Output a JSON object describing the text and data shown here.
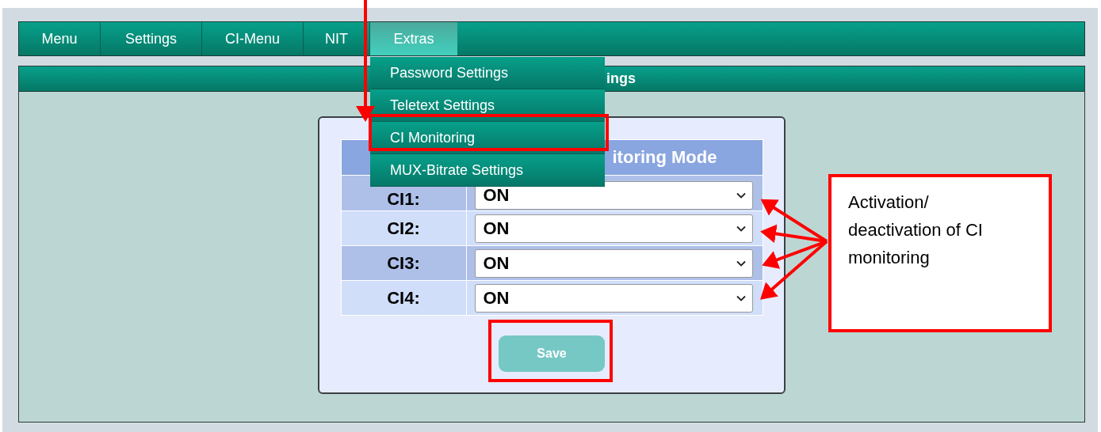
{
  "nav": {
    "tabs": [
      {
        "label": "Menu",
        "selected": false
      },
      {
        "label": "Settings",
        "selected": false
      },
      {
        "label": "CI-Menu",
        "selected": false
      },
      {
        "label": "NIT",
        "selected": false
      },
      {
        "label": "Extras",
        "selected": true
      }
    ]
  },
  "dropdown": {
    "items": [
      "Password Settings",
      "Teletext Settings",
      "CI Monitoring",
      "MUX-Bitrate Settings"
    ]
  },
  "panel": {
    "title": "ings",
    "table": {
      "header": "itoring Mode",
      "rows": [
        {
          "label": "CI1:",
          "value": "ON"
        },
        {
          "label": "CI2:",
          "value": "ON"
        },
        {
          "label": "CI3:",
          "value": "ON"
        },
        {
          "label": "CI4:",
          "value": "ON"
        }
      ]
    },
    "save_button": "Save"
  },
  "callout": {
    "text": "Activation/ deactivation of CI monitoring"
  }
}
